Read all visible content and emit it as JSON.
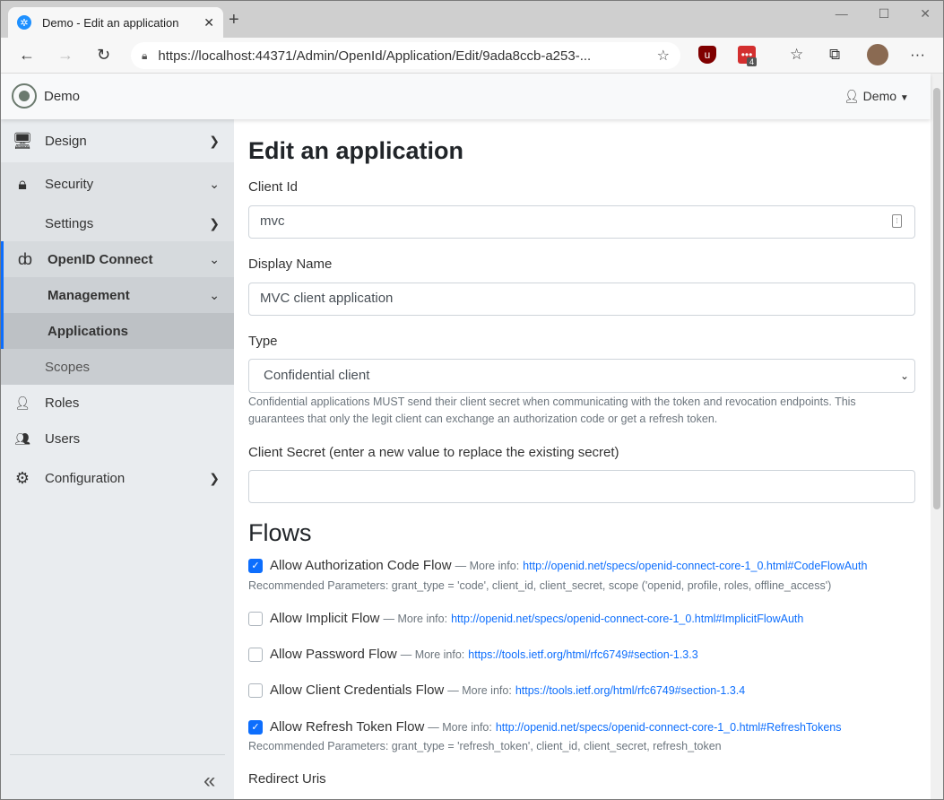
{
  "browser": {
    "tab_title": "Demo - Edit an application",
    "url": "https://localhost:44371/Admin/OpenId/Application/Edit/9ada8ccb-a253-...",
    "ext_badge": "4"
  },
  "header": {
    "brand": "Demo",
    "user": "Demo"
  },
  "sidebar": {
    "items": [
      {
        "label": "Design"
      },
      {
        "label": "Security"
      },
      {
        "label": "Settings"
      },
      {
        "label": "OpenID Connect"
      },
      {
        "label": "Management"
      },
      {
        "label": "Applications"
      },
      {
        "label": "Scopes"
      },
      {
        "label": "Roles"
      },
      {
        "label": "Users"
      },
      {
        "label": "Configuration"
      }
    ]
  },
  "form": {
    "title": "Edit an application",
    "client_id_label": "Client Id",
    "client_id_value": "mvc",
    "display_name_label": "Display Name",
    "display_name_value": "MVC client application",
    "type_label": "Type",
    "type_value": "Confidential client",
    "type_help": "Confidential applications MUST send their client secret when communicating with the token and revocation endpoints. This guarantees that only the legit client can exchange an authorization code or get a refresh token.",
    "secret_label": "Client Secret (enter a new value to replace the existing secret)",
    "secret_value": "",
    "flows_heading": "Flows",
    "redirect_label": "Redirect Uris"
  },
  "flows": [
    {
      "label": "Allow Authorization Code Flow",
      "info": "— More info:",
      "link": "http://openid.net/specs/openid-connect-core-1_0.html#CodeFlowAuth",
      "checked": true,
      "params": "Recommended Parameters: grant_type = 'code', client_id, client_secret, scope ('openid, profile, roles, offline_access')"
    },
    {
      "label": "Allow Implicit Flow",
      "info": "— More info:",
      "link": "http://openid.net/specs/openid-connect-core-1_0.html#ImplicitFlowAuth",
      "checked": false
    },
    {
      "label": "Allow Password Flow",
      "info": "— More info:",
      "link": "https://tools.ietf.org/html/rfc6749#section-1.3.3",
      "checked": false
    },
    {
      "label": "Allow Client Credentials Flow",
      "info": "— More info:",
      "link": "https://tools.ietf.org/html/rfc6749#section-1.3.4",
      "checked": false
    },
    {
      "label": "Allow Refresh Token Flow",
      "info": "— More info:",
      "link": "http://openid.net/specs/openid-connect-core-1_0.html#RefreshTokens",
      "checked": true,
      "params": "Recommended Parameters: grant_type = 'refresh_token', client_id, client_secret, refresh_token"
    }
  ],
  "colors": {
    "accent": "#0d6efd",
    "sidebar_bg": "#e9ecef",
    "sidebar_active": "#d2d6da",
    "sidebar_active_deep": "#bcc0c4",
    "active_indicator": "#0d6efd"
  }
}
